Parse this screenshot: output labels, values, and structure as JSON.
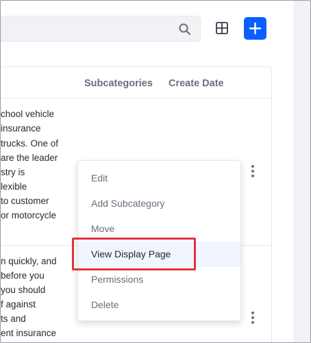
{
  "table": {
    "headers": [
      "Subcategories",
      "Create Date"
    ],
    "row1_lines": [
      "chool vehicle",
      "insurance",
      "trucks. One of",
      "are the leader",
      "stry is",
      "lexible",
      " to customer",
      "or motorcycle"
    ],
    "row2_lines": [
      "n quickly, and",
      "before you",
      "you should",
      "f against",
      "ts and",
      "ent insurance"
    ]
  },
  "menu": {
    "items": [
      "Edit",
      "Add Subcategory",
      "Move",
      "View Display Page",
      "Permissions",
      "Delete"
    ],
    "highlighted_index": 3
  },
  "icons": [
    "search-icon",
    "grid-view-icon",
    "plus-icon",
    "kebab-menu-icon"
  ],
  "colors": {
    "accent": "#0b5fff",
    "highlight_border": "#e5303d",
    "menu_hover": "#f0f5ff",
    "muted_text": "#6b6c7e"
  }
}
